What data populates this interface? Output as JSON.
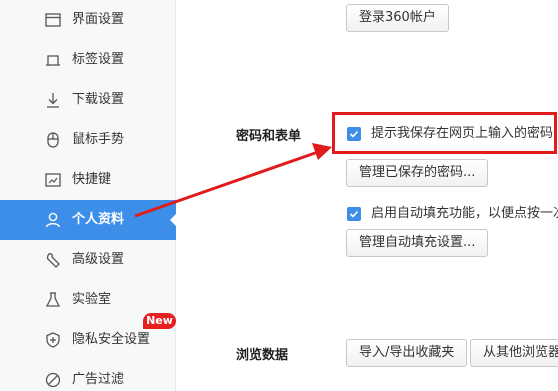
{
  "sidebar": {
    "items": [
      {
        "label": "界面设置",
        "icon": "window-icon"
      },
      {
        "label": "标签设置",
        "icon": "tab-icon"
      },
      {
        "label": "下载设置",
        "icon": "download-icon"
      },
      {
        "label": "鼠标手势",
        "icon": "mouse-icon"
      },
      {
        "label": "快捷键",
        "icon": "shortcut-icon"
      },
      {
        "label": "个人资料",
        "icon": "person-icon",
        "active": true
      },
      {
        "label": "高级设置",
        "icon": "wrench-icon"
      },
      {
        "label": "实验室",
        "icon": "flask-icon"
      },
      {
        "label": "隐私安全设置",
        "icon": "shield-icon"
      },
      {
        "label": "广告过滤",
        "icon": "block-icon"
      }
    ],
    "new_badge": "New"
  },
  "main": {
    "login_button": "登录360帐户",
    "password_section": {
      "title": "密码和表单",
      "save_password_checkbox": "提示我保存在网页上输入的密码",
      "manage_passwords_button": "管理已保存的密码...",
      "autofill_checkbox": "启用自动填充功能，以便点按一次",
      "manage_autofill_button": "管理自动填充设置..."
    },
    "browsing_section": {
      "title": "浏览数据",
      "import_export_button": "导入/导出收藏夹",
      "import_from_browser_button": "从其他浏览器"
    }
  },
  "colors": {
    "accent": "#3d8ee8",
    "annotation_red": "#e11b1b",
    "badge_red": "#e62020"
  }
}
